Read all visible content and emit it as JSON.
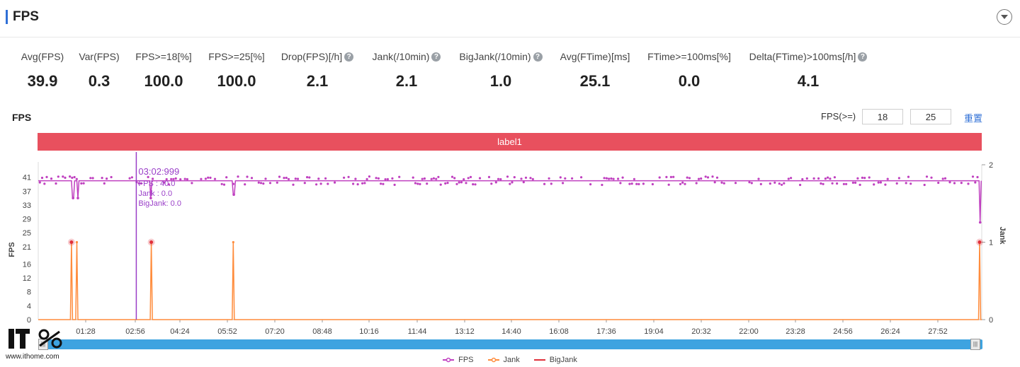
{
  "header": {
    "title": "FPS",
    "collapse_icon": "chevron-down-icon"
  },
  "stats": [
    {
      "label": "Avg(FPS)",
      "value": "39.9",
      "help": false
    },
    {
      "label": "Var(FPS)",
      "value": "0.3",
      "help": false
    },
    {
      "label": "FPS>=18[%]",
      "value": "100.0",
      "help": false
    },
    {
      "label": "FPS>=25[%]",
      "value": "100.0",
      "help": false
    },
    {
      "label": "Drop(FPS)[/h]",
      "value": "2.1",
      "help": true
    },
    {
      "label": "Jank(/10min)",
      "value": "2.1",
      "help": true
    },
    {
      "label": "BigJank(/10min)",
      "value": "1.0",
      "help": true
    },
    {
      "label": "Avg(FTime)[ms]",
      "value": "25.1",
      "help": false
    },
    {
      "label": "FTime>=100ms[%]",
      "value": "0.0",
      "help": false
    },
    {
      "label": "Delta(FTime)>100ms[/h]",
      "value": "4.1",
      "help": true
    }
  ],
  "fps_panel": {
    "title": "FPS",
    "threshold_label": "FPS(>=)",
    "threshold_1": "18",
    "threshold_2": "25",
    "reset_label": "重置",
    "band_label": "label1"
  },
  "chart_data": {
    "type": "line",
    "x_ticks": [
      "01:28",
      "02:56",
      "04:24",
      "05:52",
      "07:20",
      "08:48",
      "10:16",
      "11:44",
      "13:12",
      "14:40",
      "16:08",
      "17:36",
      "19:04",
      "20:32",
      "22:00",
      "23:28",
      "24:56",
      "26:24",
      "27:52"
    ],
    "x_range_seconds": [
      0,
      1761
    ],
    "y_left": {
      "label": "FPS",
      "ticks": [
        0,
        4,
        8,
        12,
        16,
        21,
        25,
        29,
        33,
        37,
        41
      ],
      "range": [
        0,
        45
      ]
    },
    "y_right": {
      "label": "Jank",
      "ticks": [
        0,
        1,
        2
      ],
      "range": [
        0,
        2
      ]
    },
    "series": [
      {
        "name": "FPS",
        "color": "#c040c0",
        "baseline": 40,
        "dips": [
          {
            "t": 65,
            "v": 35
          },
          {
            "t": 74,
            "v": 35
          },
          {
            "t": 210,
            "v": 35
          },
          {
            "t": 365,
            "v": 36
          },
          {
            "t": 1758,
            "v": 28
          }
        ]
      },
      {
        "name": "Jank",
        "color": "#ff8c3c",
        "spikes": [
          {
            "t": 62,
            "v": 1
          },
          {
            "t": 72,
            "v": 1
          },
          {
            "t": 211,
            "v": 1
          },
          {
            "t": 364,
            "v": 1
          },
          {
            "t": 1757,
            "v": 1
          }
        ]
      },
      {
        "name": "BigJank",
        "color": "#e0303a",
        "markers": [
          {
            "t": 62,
            "v": 1
          },
          {
            "t": 211,
            "v": 1
          },
          {
            "t": 1757,
            "v": 1
          }
        ]
      }
    ],
    "cursor": {
      "t": 183,
      "time": "03:02:999",
      "lines": [
        "FPS     : 40.0",
        "Jank     : 0.0",
        "BigJank: 0.0"
      ]
    }
  },
  "watermark": {
    "url": "www.ithome.com"
  }
}
